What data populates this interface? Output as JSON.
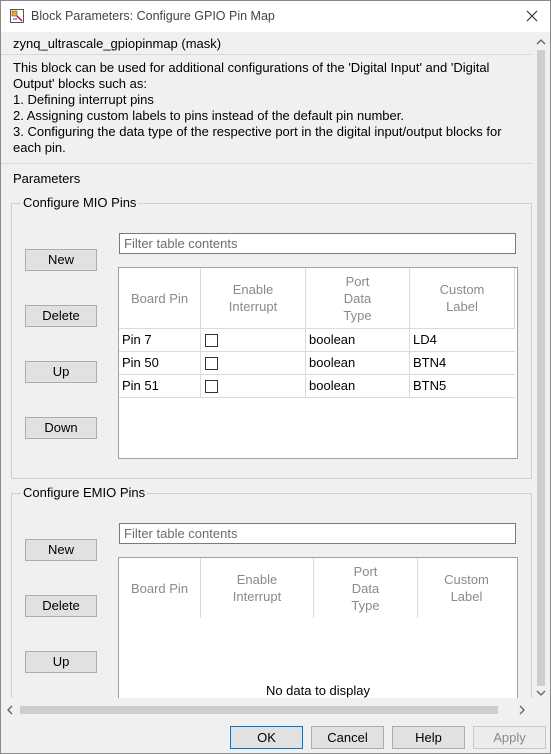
{
  "window": {
    "title": "Block Parameters: Configure GPIO Pin Map"
  },
  "mask_title": "zynq_ultrascale_gpiopinmap (mask)",
  "description": [
    "This block can be used for additional configurations of the 'Digital Input' and 'Digital",
    "Output' blocks such as:",
    "1. Defining interrupt pins",
    "2. Assigning custom labels to pins instead of the default pin number.",
    "3. Configuring the data type of the respective port in the digital input/output blocks for",
    "each pin."
  ],
  "parameters_label": "Parameters",
  "mio": {
    "label": "Configure MIO Pins",
    "buttons": {
      "new": "New",
      "delete": "Delete",
      "up": "Up",
      "down": "Down"
    },
    "filter_placeholder": "Filter table contents",
    "columns": [
      "Board Pin",
      "Enable\nInterrupt",
      "Port\nData\nType",
      "Custom\nLabel"
    ],
    "rows": [
      {
        "board_pin": "Pin 7",
        "enable_interrupt": false,
        "port_type": "boolean",
        "custom_label": "LD4"
      },
      {
        "board_pin": "Pin 50",
        "enable_interrupt": false,
        "port_type": "boolean",
        "custom_label": "BTN4"
      },
      {
        "board_pin": "Pin 51",
        "enable_interrupt": false,
        "port_type": "boolean",
        "custom_label": "BTN5"
      }
    ]
  },
  "emio": {
    "label": "Configure EMIO Pins",
    "buttons": {
      "new": "New",
      "delete": "Delete",
      "up": "Up"
    },
    "filter_placeholder": "Filter table contents",
    "columns": [
      "Board Pin",
      "Enable\nInterrupt",
      "Port\nData\nType",
      "Custom\nLabel"
    ],
    "empty_text": "No data to display"
  },
  "footer": {
    "ok": "OK",
    "cancel": "Cancel",
    "help": "Help",
    "apply": "Apply"
  }
}
